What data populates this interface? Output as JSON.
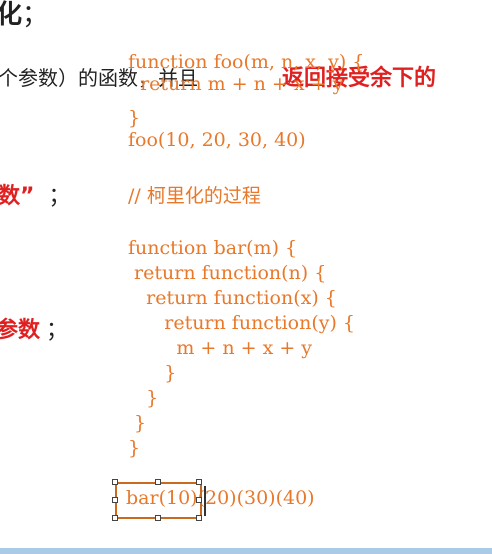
{
  "left_text": {
    "line1_tail": "化",
    "line1_punct": "；",
    "line2_black": "个参数）的函数，并且",
    "line2_red": "返回接受余下的",
    "line3_red": "数”",
    "line3_punct": "；",
    "line4_red": "参数",
    "line4_punct": "；"
  },
  "code": {
    "foo_def_line1": "function foo(m, n, x, y) {",
    "foo_def_line2": "  return m + n + x + y",
    "foo_close": "}",
    "foo_call": "foo(10, 20, 30, 40)",
    "comment": "// 柯里化的过程",
    "bar_lines": [
      "function bar(m) {",
      " return function(n) {",
      "   return function(x) {",
      "      return function(y) {",
      "        m + n + x + y",
      "      }",
      "   }",
      " }",
      "}"
    ],
    "bar_call": "bar(10)(20)(30)(40)"
  },
  "colors": {
    "code": "#e8782a",
    "highlight": "#e02020",
    "selection": "#c96a1e",
    "bottom_bar": "#a9cbe8"
  }
}
